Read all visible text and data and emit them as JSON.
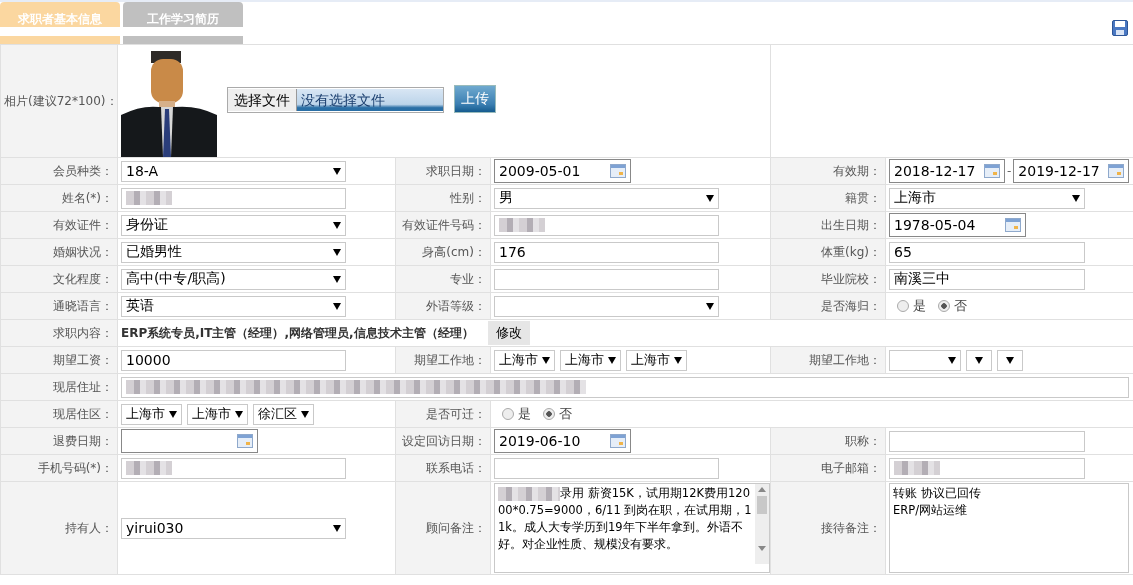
{
  "tabs": [
    {
      "label": "求职者基本信息",
      "selected": true
    },
    {
      "label": "工作学习简历",
      "selected": false
    }
  ],
  "photo": {
    "label": "相片(建议72*100)：",
    "choose_button": "选择文件",
    "file_status": "没有选择文件",
    "upload_button": "上传"
  },
  "rows": [
    {
      "cells": [
        {
          "label": "会员种类：",
          "field": {
            "kind": "select",
            "value": "18-A"
          }
        },
        {
          "label": "求职日期：",
          "field": {
            "kind": "date",
            "value": "2009-05-01"
          }
        },
        {
          "label": "有效期：",
          "field": {
            "kind": "daterange",
            "from": "2018-12-17",
            "separator": "-",
            "to": "2019-12-17"
          }
        }
      ]
    },
    {
      "cells": [
        {
          "label": "姓名(*)：",
          "field": {
            "kind": "redacted"
          }
        },
        {
          "label": "性别：",
          "field": {
            "kind": "select",
            "value": "男"
          }
        },
        {
          "label": "籍贯：",
          "field": {
            "kind": "select",
            "value": "上海市"
          }
        }
      ]
    },
    {
      "cells": [
        {
          "label": "有效证件：",
          "field": {
            "kind": "select",
            "value": "身份证"
          }
        },
        {
          "label": "有效证件号码：",
          "field": {
            "kind": "redacted"
          }
        },
        {
          "label": "出生日期：",
          "field": {
            "kind": "date",
            "value": "1978-05-04"
          }
        }
      ]
    },
    {
      "cells": [
        {
          "label": "婚姻状况：",
          "field": {
            "kind": "select",
            "value": "已婚男性"
          }
        },
        {
          "label": "身高(cm)：",
          "field": {
            "kind": "text",
            "value": "176"
          }
        },
        {
          "label": "体重(kg)：",
          "field": {
            "kind": "text",
            "value": "65"
          }
        }
      ]
    },
    {
      "cells": [
        {
          "label": "文化程度：",
          "field": {
            "kind": "select",
            "value": "高中(中专/职高)"
          }
        },
        {
          "label": "专业：",
          "field": {
            "kind": "text"
          }
        },
        {
          "label": "毕业院校：",
          "field": {
            "kind": "text",
            "value": "南溪三中"
          }
        }
      ]
    },
    {
      "cells": [
        {
          "label": "通晓语言：",
          "field": {
            "kind": "select",
            "value": "英语"
          }
        },
        {
          "label": "外语等级：",
          "field": {
            "kind": "select"
          }
        },
        {
          "label": "是否海归：",
          "field": {
            "kind": "radio",
            "options": [
              {
                "label": "是",
                "selected": false
              },
              {
                "label": "否",
                "selected": true
              }
            ]
          }
        }
      ]
    },
    {
      "cells": [
        {
          "label": "求职内容：",
          "field": {
            "kind": "jobs",
            "value": "ERP系统专员,IT主管（经理）,网络管理员,信息技术主管（经理）",
            "button": "修改"
          }
        }
      ]
    },
    {
      "cells": [
        {
          "label": "期望工资：",
          "field": {
            "kind": "text",
            "value": "10000"
          }
        },
        {
          "label": "期望工作地：",
          "field": {
            "kind": "selects",
            "values": [
              "上海市",
              "上海市",
              "上海市"
            ]
          }
        },
        {
          "label": "期望工作地：",
          "field": {
            "kind": "selects",
            "values": [
              {
                "kind": "blank"
              },
              {
                "kind": "blank"
              },
              {
                "kind": "blank"
              }
            ]
          }
        }
      ]
    },
    {
      "cells": [
        {
          "label": "现居住址：",
          "field": {
            "kind": "redacted"
          }
        }
      ]
    },
    {
      "cells": [
        {
          "label": "现居住区：",
          "field": {
            "kind": "selects",
            "values": [
              "上海市",
              "上海市",
              "徐汇区"
            ]
          }
        },
        {
          "label": "是否可迁：",
          "field": {
            "kind": "radio",
            "options": [
              {
                "label": "是",
                "selected": false
              },
              {
                "label": "否",
                "selected": true
              }
            ]
          }
        }
      ]
    },
    {
      "cells": [
        {
          "label": "退费日期：",
          "field": {
            "kind": "date"
          }
        },
        {
          "label": "设定回访日期：",
          "field": {
            "kind": "date",
            "value": "2019-06-10"
          }
        },
        {
          "label": "职称：",
          "field": {
            "kind": "text"
          }
        }
      ]
    },
    {
      "cells": [
        {
          "label": "手机号码(*)：",
          "field": {
            "kind": "redacted"
          }
        },
        {
          "label": "联系电话：",
          "field": {
            "kind": "text"
          }
        },
        {
          "label": "电子邮箱：",
          "field": {
            "kind": "redacted"
          }
        }
      ]
    },
    {
      "cells": [
        {
          "label": "持有人：",
          "field": {
            "kind": "select",
            "value": "yirui030"
          }
        },
        {
          "label": "顾问备注：",
          "field": {
            "kind": "textarea",
            "redacted_prefix": true,
            "value": "录用 薪资15K，试用期12K费用12000*0.75=9000，6/11 到岗在职，在试用期，11k。成人大专学历到19年下半年拿到。外语不好。对企业性质、规模没有要求。"
          }
        },
        {
          "label": "接待备注：",
          "field": {
            "kind": "textarea",
            "lines": [
              "转账 协议已回传",
              "ERP/网站运维"
            ]
          }
        }
      ]
    }
  ]
}
